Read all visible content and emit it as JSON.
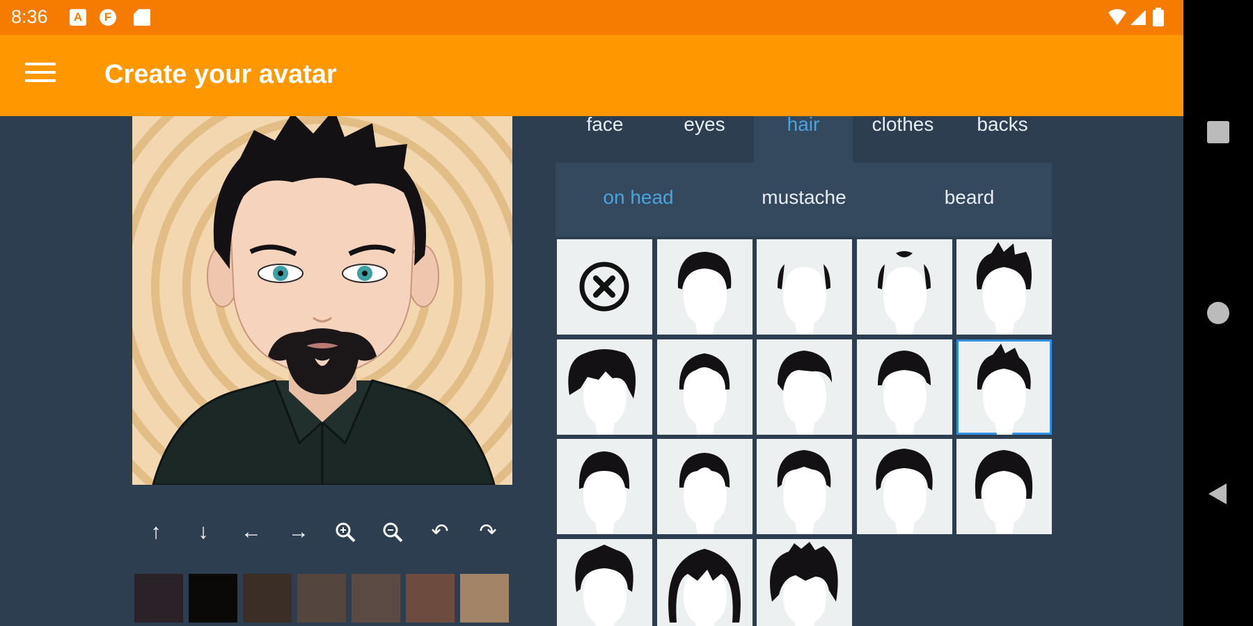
{
  "status_bar": {
    "time": "8:36",
    "notification_icons": [
      "a-icon",
      "f-icon",
      "sd-card-icon"
    ],
    "system_icons": [
      "wifi-icon",
      "signal-icon",
      "battery-icon"
    ]
  },
  "app_bar": {
    "menu_icon": "menu-icon",
    "title": "Create your avatar"
  },
  "category_tabs": [
    {
      "label": "face",
      "active": false
    },
    {
      "label": "eyes",
      "active": false
    },
    {
      "label": "hair",
      "active": true
    },
    {
      "label": "clothes",
      "active": false
    },
    {
      "label": "backs",
      "active": false
    }
  ],
  "hair_subtabs": [
    {
      "label": "on head",
      "active": true
    },
    {
      "label": "mustache",
      "active": false
    },
    {
      "label": "beard",
      "active": false
    }
  ],
  "hair_styles": {
    "count": 18,
    "selected_index": 9,
    "first_item": "none-icon"
  },
  "edit_tools": [
    "move-up-icon",
    "move-down-icon",
    "move-left-icon",
    "move-right-icon",
    "zoom-in-icon",
    "zoom-out-icon",
    "undo-icon",
    "redo-icon"
  ],
  "hair_colors": [
    "#2a2228",
    "#0a0908",
    "#3a2e27",
    "#54453f",
    "#5b4a44",
    "#6d4c3f",
    "#a48466"
  ],
  "nav_bar": [
    "recents-icon",
    "home-icon",
    "back-icon"
  ],
  "colors": {
    "status_bar": "#f57c00",
    "app_bar": "#ff9800",
    "background": "#2d3e50",
    "panel": "#34495e",
    "active_tab": "#4aa3df"
  }
}
